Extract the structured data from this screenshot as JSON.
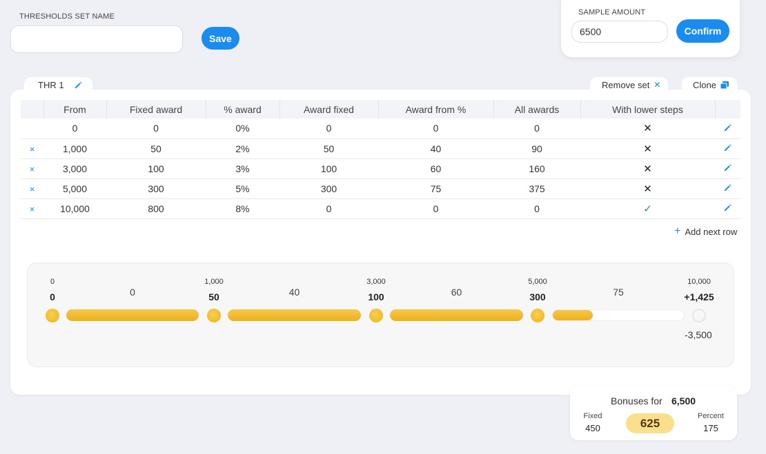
{
  "header": {
    "set_name_label": "THRESHOLDS SET NAME",
    "set_name_value": "",
    "save_label": "Save",
    "sample_label": "SAMPLE AMOUNT",
    "sample_value": "6500",
    "confirm_label": "Confirm"
  },
  "tabs": {
    "set_tab": "THR 1",
    "remove_set": "Remove set",
    "clone": "Clone"
  },
  "table": {
    "columns": [
      "From",
      "Fixed award",
      "% award",
      "Award fixed",
      "Award from %",
      "All awards",
      "With lower steps"
    ],
    "rows": [
      {
        "deletable": false,
        "from": "0",
        "fixed_award": "0",
        "pct_award": "0%",
        "award_fixed": "0",
        "award_from_pct": "0",
        "all_awards": "0",
        "with_lower": false
      },
      {
        "deletable": true,
        "from": "1,000",
        "fixed_award": "50",
        "pct_award": "2%",
        "award_fixed": "50",
        "award_from_pct": "40",
        "all_awards": "90",
        "with_lower": false
      },
      {
        "deletable": true,
        "from": "3,000",
        "fixed_award": "100",
        "pct_award": "3%",
        "award_fixed": "100",
        "award_from_pct": "60",
        "all_awards": "160",
        "with_lower": false
      },
      {
        "deletable": true,
        "from": "5,000",
        "fixed_award": "300",
        "pct_award": "5%",
        "award_fixed": "300",
        "award_from_pct": "75",
        "all_awards": "375",
        "with_lower": false
      },
      {
        "deletable": true,
        "from": "10,000",
        "fixed_award": "800",
        "pct_award": "8%",
        "award_fixed": "0",
        "award_from_pct": "0",
        "all_awards": "0",
        "with_lower": true
      }
    ],
    "add_row_label": "Add next row"
  },
  "progress": {
    "thresholds": [
      {
        "from": "0",
        "award": "0"
      },
      {
        "from": "1,000",
        "award": "50"
      },
      {
        "from": "3,000",
        "award": "100"
      },
      {
        "from": "5,000",
        "award": "300"
      },
      {
        "from": "10,000",
        "award": "+1,425"
      }
    ],
    "segments": [
      {
        "pct_award": "0",
        "fill": 1.0
      },
      {
        "pct_award": "40",
        "fill": 1.0
      },
      {
        "pct_award": "60",
        "fill": 1.0
      },
      {
        "pct_award": "75",
        "fill": 0.3
      }
    ],
    "remaining": "-3,500"
  },
  "bonus": {
    "label": "Bonuses for",
    "amount": "6,500",
    "fixed_label": "Fixed",
    "fixed_value": "450",
    "total": "625",
    "percent_label": "Percent",
    "percent_value": "175"
  },
  "colors": {
    "accent": "#1a8cf0",
    "bar_gold": "#f2bd33",
    "check_green": "#2e9a3e",
    "total_pill": "#fbdf8c"
  }
}
